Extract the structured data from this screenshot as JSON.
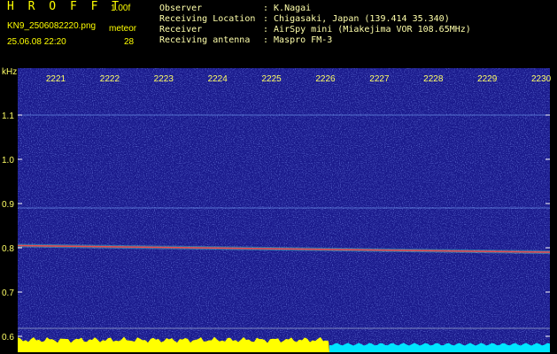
{
  "header": {
    "app_name": "H R O F F T",
    "version": "1.00f",
    "filename": "KN9_2506082220.png",
    "datetime": "25.06.08 22:20",
    "meteor_label": "meteor",
    "meteor_count": "28",
    "info": [
      {
        "label": "Observer",
        "value": ": K.Nagai"
      },
      {
        "label": "Receiving Location",
        "value": ": Chigasaki, Japan (139.414 35.340)"
      },
      {
        "label": "Receiver",
        "value": ": AirSpy mini (Miakejima VOR 108.65MHz)"
      },
      {
        "label": "Receiving antenna",
        "value": ": Maspro FM-3"
      }
    ]
  },
  "colors": {
    "background": "#1a1a8c",
    "label": "#ffff00",
    "power_bar_early": "#ffff00",
    "power_bar_late": "#00e5ff",
    "carrier": "#ff4444"
  },
  "chart_data": {
    "type": "heatmap",
    "ylabel": "kHz",
    "ylim": [
      0.6,
      1.2
    ],
    "yticks": [
      "0.6",
      "0.7",
      "0.8",
      "0.9",
      "1.0",
      "1.1"
    ],
    "ytick_values": [
      0.6,
      0.7,
      0.8,
      0.9,
      1.0,
      1.1
    ],
    "xticks": [
      "2221",
      "2222",
      "2223",
      "2224",
      "2225",
      "2226",
      "2227",
      "2228",
      "2229",
      "2230"
    ],
    "xlim": [
      "2220",
      "2230"
    ],
    "carrier_khz_start": 0.805,
    "carrier_khz_end": 0.79,
    "weak_lines_khz": [
      0.89,
      1.1
    ]
  }
}
